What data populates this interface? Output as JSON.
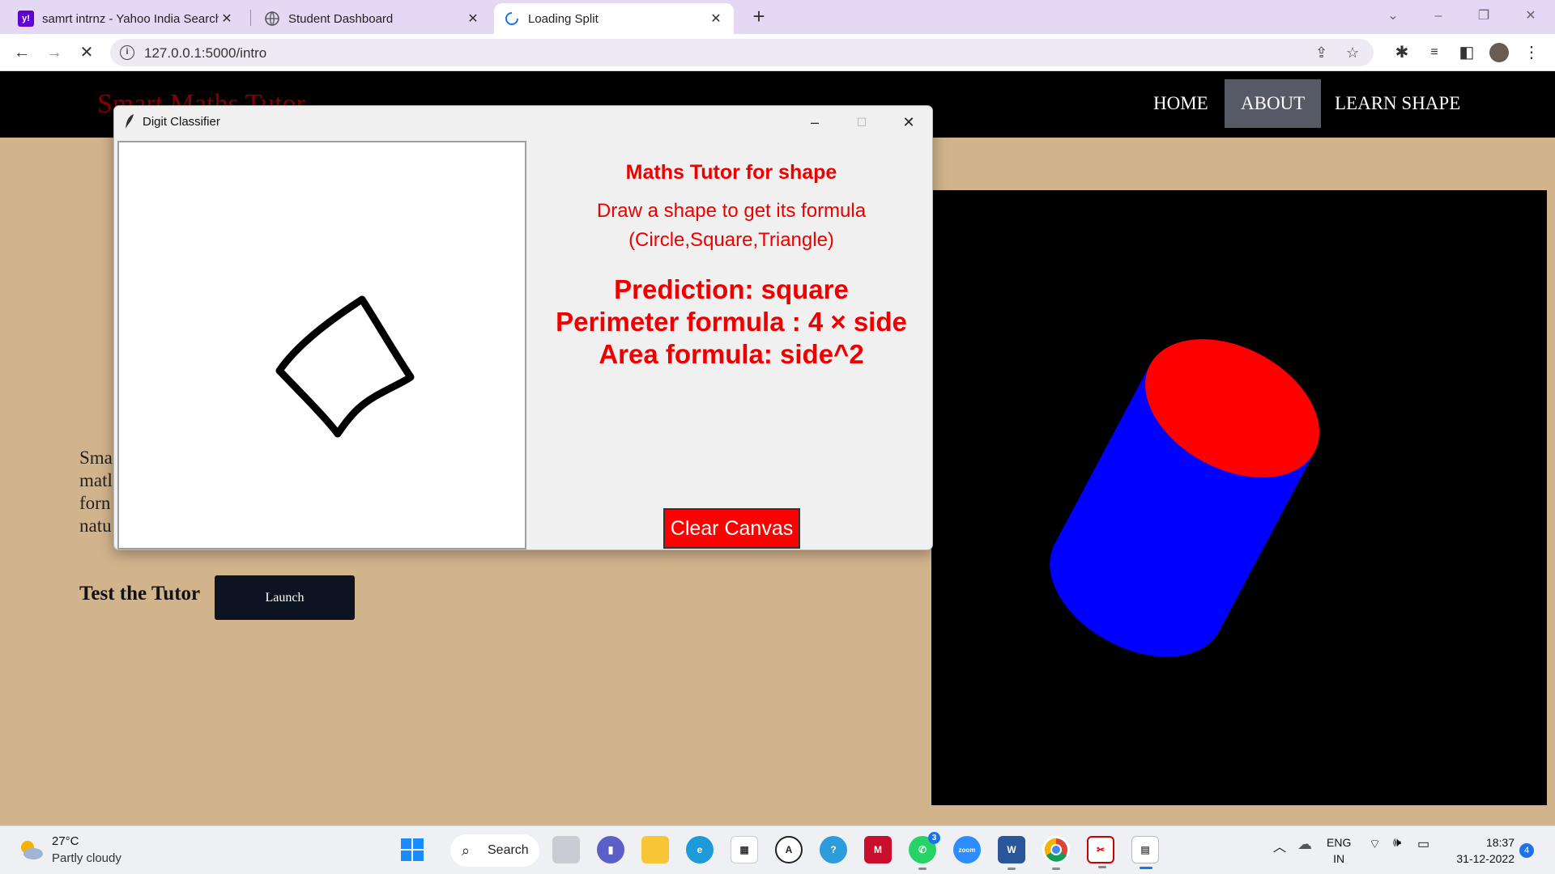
{
  "browser": {
    "tabs": [
      {
        "title": "samrt intrnz - Yahoo India Search"
      },
      {
        "title": "Student Dashboard"
      },
      {
        "title": "Loading Split"
      }
    ],
    "url": "127.0.0.1:5000/intro"
  },
  "site": {
    "logo": "Smart Maths Tutor",
    "nav": [
      {
        "label": "HOME"
      },
      {
        "label": "ABOUT"
      },
      {
        "label": "LEARN SHAPE"
      }
    ],
    "intro_lines": [
      "Sma",
      "matl",
      "forn",
      "natu"
    ],
    "test_label": "Test the Tutor",
    "launch_label": "Launch"
  },
  "app_window": {
    "title": "Digit Classifier",
    "heading": "Maths Tutor for shape",
    "instruction_line1": "Draw a shape to get its formula",
    "instruction_line2": "(Circle,Square,Triangle)",
    "prediction": "Prediction: square",
    "perimeter": "Perimeter formula : 4 × side",
    "area": "Area formula: side^2",
    "clear_button": "Clear Canvas"
  },
  "taskbar": {
    "weather_temp": "27°C",
    "weather_desc": "Partly cloudy",
    "search_label": "Search",
    "teams_badge": "",
    "whatsapp_badge": "3",
    "lang_line1": "ENG",
    "lang_line2": "IN",
    "time": "18:37",
    "date": "31-12-2022",
    "notifications": "4"
  },
  "colors": {
    "accent_red": "#ee0000",
    "cylinder_body": "#0000ff",
    "cylinder_top": "#ff0000",
    "page_bg": "#d2b48c"
  }
}
